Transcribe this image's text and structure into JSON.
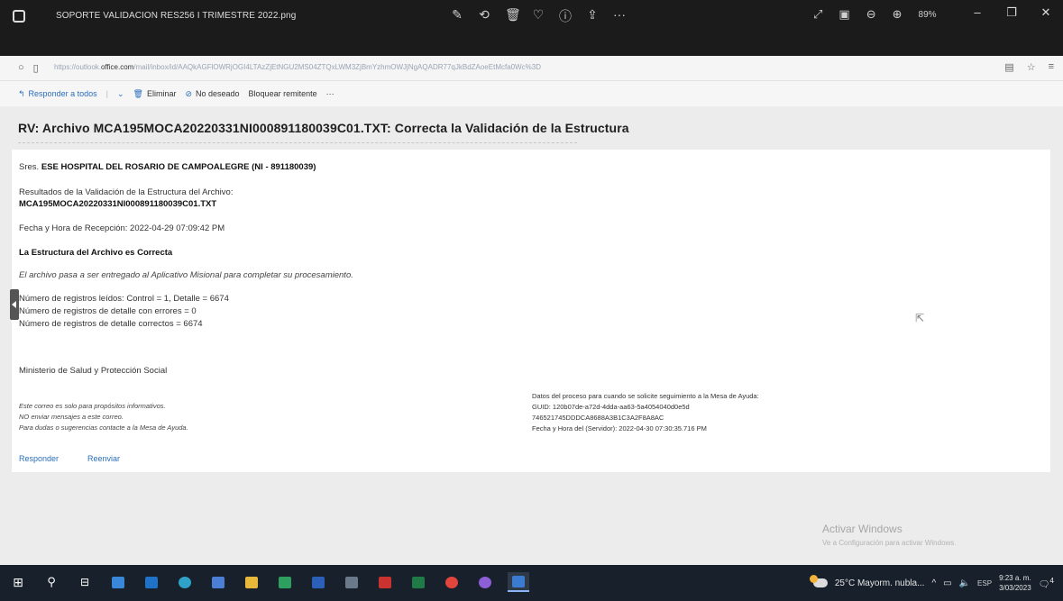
{
  "viewer": {
    "file_name": "SOPORTE VALIDACION RES256 I TRIMESTRE 2022.png",
    "zoom": "89%",
    "more": "···"
  },
  "browser": {
    "url_prefix": "https://outlook.",
    "url_domain": "office.com",
    "url_rest": "/mail/inbox/id/AAQkAGFlOWRjOGI4LTAzZjEtNGU2MS04ZTQxLWM3ZjBmYzhmOWJjNgAQADR77qJkBdZAoeEtMcfa0Wc%3D"
  },
  "toolbar": {
    "reply_all": "Responder a todos",
    "delete": "Eliminar",
    "junk": "No deseado",
    "block": "Bloquear remitente",
    "more": "···"
  },
  "message": {
    "subject": "RV: Archivo MCA195MOCA20220331NI000891180039C01.TXT: Correcta la Validación de la Estructura",
    "greeting_prefix": "Sres.",
    "greeting_org": "ESE HOSPITAL DEL ROSARIO DE CAMPOALEGRE (NI - 891180039)",
    "results_label": "Resultados de la Validación de la Estructura del Archivo:",
    "file_name": "MCA195MOCA20220331NI000891180039C01.TXT",
    "received": "Fecha y Hora de Recepción: 2022-04-29 07:09:42 PM",
    "structure_ok": "La Estructura del Archivo es Correcta",
    "delivered_note": "El archivo pasa a ser entregado al Aplicativo Misional para completar su procesamiento.",
    "count_read": "Número de registros leídos: Control = 1, Detalle = 6674",
    "count_errors": "Número de registros de detalle con errores = 0",
    "count_correct": "Número de registros de detalle correctos = 6674",
    "ministry": "Ministerio de Salud y Protección Social",
    "footer_left": [
      "Este correo es solo para propósitos informativos.",
      "NO enviar mensajes a este correo.",
      "Para dudas o sugerencias contacte a la Mesa de Ayuda."
    ],
    "footer_right": [
      "Datos del proceso para cuando se solicite seguimiento a la Mesa de Ayuda:",
      "GUID: 120b07de-a72d-4dda-aa63-5a4054040d0e5d",
      "746521745DDDCA8688A3B1C3A2F8A8AC",
      "Fecha y Hora del (Servidor): 2022-04-30 07:30:35.716 PM"
    ],
    "reply": "Responder",
    "forward": "Reenviar"
  },
  "watermark": {
    "line1": "Activar Windows",
    "line2": "Ve a Configuración para activar Windows."
  },
  "taskbar": {
    "weather": "25°C  Mayorm. nubla...",
    "lang": "ESP",
    "time": "9:23 a. m.",
    "date": "3/03/2023",
    "notif_count": "4"
  }
}
